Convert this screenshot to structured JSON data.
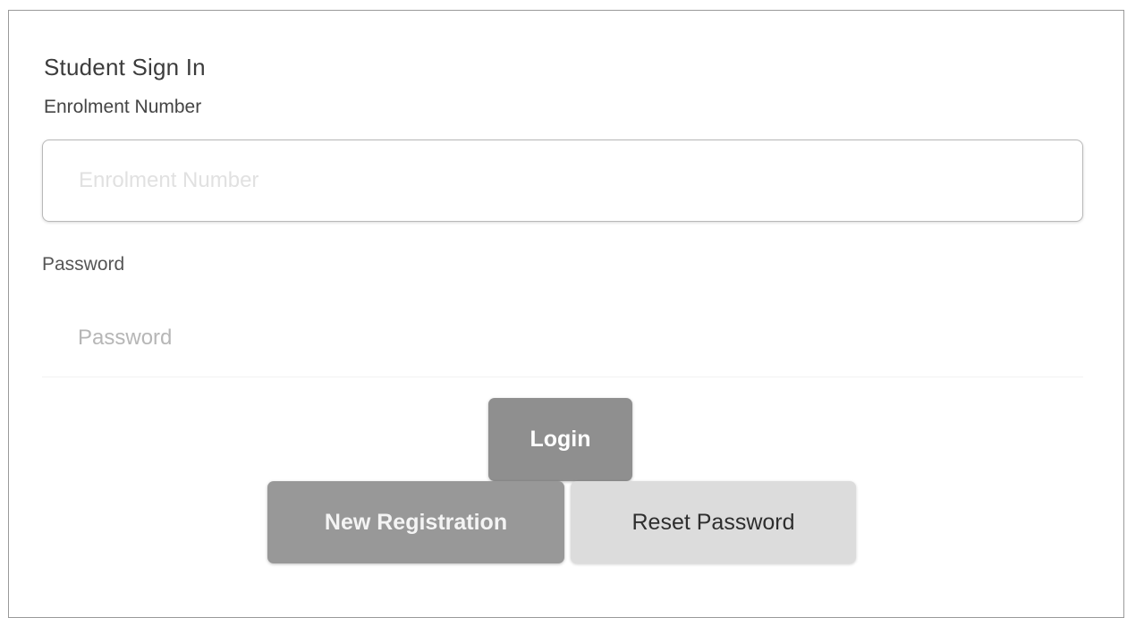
{
  "form": {
    "title": "Student Sign In",
    "enrolment_label": "Enrolment Number",
    "enrolment_placeholder": "Enrolment Number",
    "enrolment_value": "",
    "password_label": "Password",
    "password_placeholder": "Password",
    "password_value": ""
  },
  "buttons": {
    "login": "Login",
    "new_registration": "New Registration",
    "reset_password": "Reset Password"
  },
  "colors": {
    "login_bg": "#8f8f8f",
    "register_bg": "#989898",
    "reset_bg": "#dcdcdc",
    "border": "#9a9a9a"
  }
}
